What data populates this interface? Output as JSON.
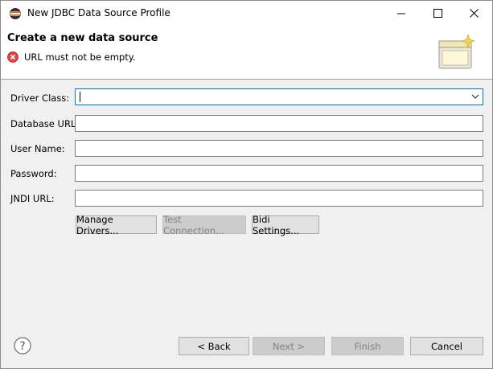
{
  "window": {
    "title": "New JDBC Data Source Profile"
  },
  "header": {
    "title": "Create a new data source",
    "error_message": "URL must not be empty."
  },
  "form": {
    "driver_class_label": "Driver Class:",
    "driver_class_value": "",
    "database_url_label": "Database URL:",
    "database_url_value": "",
    "user_name_label": "User Name:",
    "user_name_value": "",
    "password_label": "Password:",
    "password_value": "",
    "jndi_url_label": "JNDI URL:",
    "jndi_url_value": ""
  },
  "actions": {
    "manage_drivers": "Manage Drivers...",
    "test_connection": "Test Connection...",
    "bidi_settings": "Bidi Settings..."
  },
  "footer": {
    "back": "< Back",
    "next": "Next >",
    "finish": "Finish",
    "cancel": "Cancel"
  },
  "colors": {
    "focus_border": "#0078d7",
    "error_icon": "#e81123"
  },
  "icons": [
    "app-icon",
    "minimize-icon",
    "maximize-icon",
    "close-icon",
    "error-icon",
    "wizard-banner-icon",
    "chevron-down-icon",
    "help-icon"
  ]
}
